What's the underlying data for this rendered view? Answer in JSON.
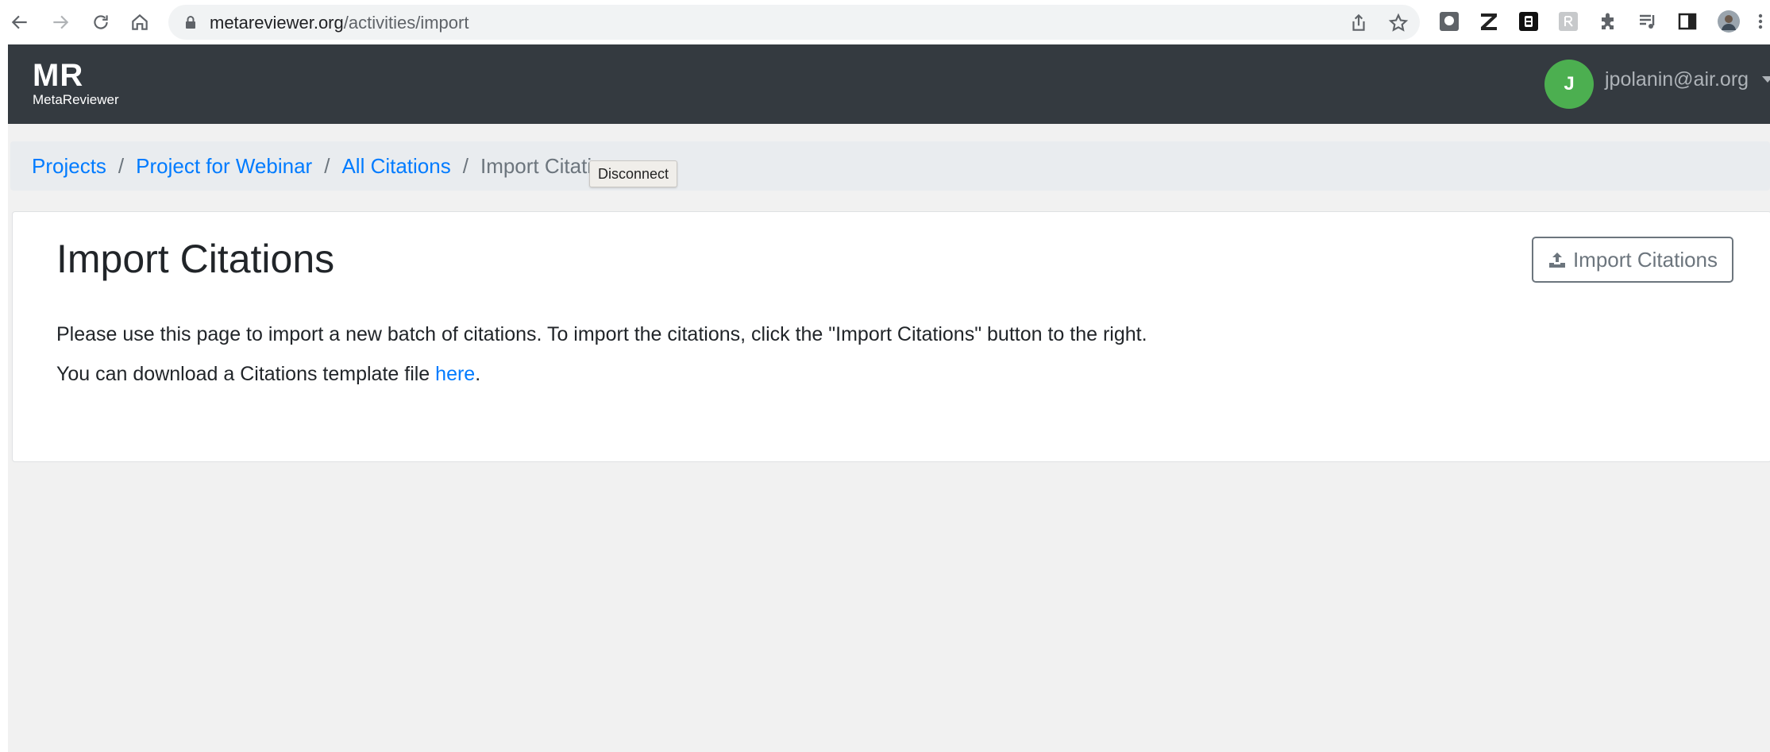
{
  "browser": {
    "url_domain": "metareviewer.org",
    "url_path": "/activities/import"
  },
  "header": {
    "brand_short": "MR",
    "brand_name": "MetaReviewer",
    "avatar_initial": "J",
    "avatar_color": "#4caf50",
    "user_email": "jpolanin@air.org"
  },
  "breadcrumb": {
    "items": [
      "Projects",
      "Project for Webinar",
      "All Citations"
    ],
    "current": "Import Citations",
    "separator": "/"
  },
  "tooltip": "Disconnect",
  "main": {
    "title": "Import Citations",
    "import_button_label": "Import Citations",
    "paragraph1": "Please use this page to import a new batch of citations. To import the citations, click the \"Import Citations\" button to the right.",
    "paragraph2_before": "You can download a Citations template file ",
    "paragraph2_link": "here",
    "paragraph2_after": "."
  },
  "colors": {
    "header_bg": "#343a40",
    "link": "#007bff",
    "page_bg": "#f1f1f1"
  }
}
